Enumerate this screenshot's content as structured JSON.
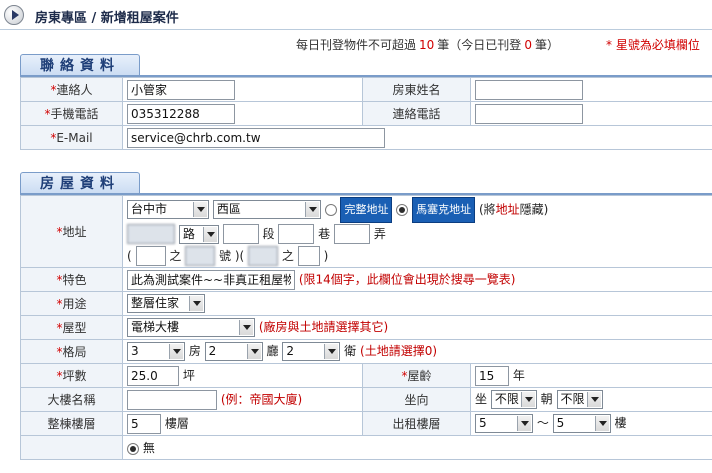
{
  "header": {
    "title": "房東專區 / 新增租屋案件"
  },
  "notice": {
    "prefix": "每日刊登物件不可超過",
    "limit": "10",
    "mid": "筆（今日已刊登",
    "posted": "0",
    "suffix": "筆）",
    "required_note": "* 星號為必填欄位"
  },
  "contact": {
    "section_title": "聯絡資料",
    "contact_label": "連絡人",
    "contact_value": "小管家",
    "landlord_label": "房東姓名",
    "landlord_value": "",
    "mobile_label": "手機電話",
    "mobile_value": "035312288",
    "phone_label": "連絡電話",
    "phone_value": "",
    "email_label": "E-Mail",
    "email_value": "service@chrb.com.tw"
  },
  "house": {
    "section_title": "房屋資料",
    "address_label": "地址",
    "city": "台中市",
    "district": "西區",
    "full_address_btn": "完整地址",
    "mosaic_address_btn": "馬塞克地址",
    "hidden_note_pre": "(將",
    "hidden_note_hl": "地址",
    "hidden_note_post": "隱藏)",
    "road_suffix": "路",
    "section_word": "段",
    "lane_word": "巷",
    "alley_word": "弄",
    "of_word": "之",
    "number_word": "號",
    "paren_open": "(",
    "paren_close": ")",
    "paren_open2": ")(",
    "feature_label": "特色",
    "feature_value": "此為測試案件~~非真正租屋物",
    "feature_hint": "(限14個字，此欄位會出現於搜尋一覽表)",
    "usage_label": "用途",
    "usage_value": "整層住家",
    "type_label": "屋型",
    "type_value": "電梯大樓",
    "type_hint": "(廠房與土地請選擇其它)",
    "layout_label": "格局",
    "rooms": "3",
    "room_word": "房",
    "halls": "2",
    "hall_word": "廳",
    "baths": "2",
    "bath_word": "衛",
    "layout_hint": "(土地請選擇0)",
    "area_label": "坪數",
    "area_value": "25.0",
    "area_unit": "坪",
    "age_label": "屋齡",
    "age_value": "15",
    "age_unit": "年",
    "building_label": "大樓名稱",
    "building_value": "",
    "building_hint": "(例：帝國大廈)",
    "facing_label": "坐向",
    "sit_word": "坐",
    "sit_value": "不限",
    "face_word": "朝",
    "face_value": "不限",
    "floors_label": "整棟樓層",
    "floors_value": "5",
    "floors_unit": "樓層",
    "rent_floor_label": "出租樓層",
    "rent_from": "5",
    "tilde": "～",
    "rent_to": "5",
    "rent_unit": "樓",
    "last_option": "無"
  }
}
